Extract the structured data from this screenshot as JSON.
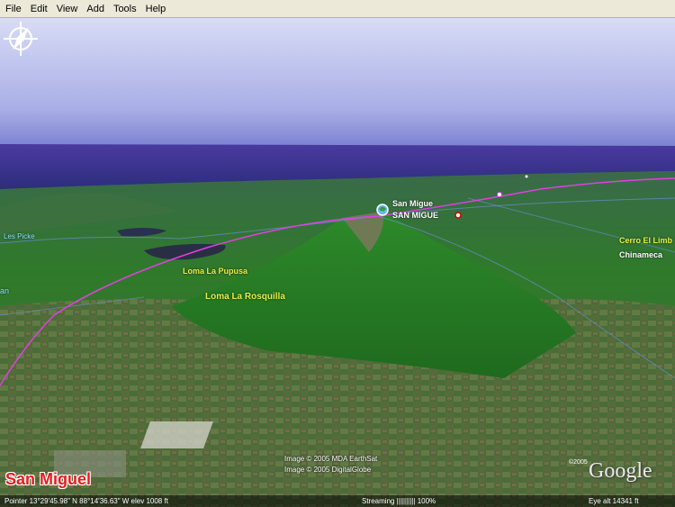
{
  "menu": {
    "items": [
      "File",
      "Edit",
      "View",
      "Add",
      "Tools",
      "Help"
    ]
  },
  "map": {
    "labels": {
      "san_miguel_point": "San Migue",
      "san_miguel_city": "SAN MIGUE",
      "loma_pupusa": "Loma La Pupusa",
      "loma_rosquilla": "Loma La Rosquilla",
      "cerro_el_limbo": "Cerro El Limb",
      "chinameca": "Chinameca",
      "los_picke": "Les Picke",
      "left_edge": "an"
    },
    "place_title": "San Miguel",
    "copyright_line1": "Image © 2005 MDA EarthSat",
    "copyright_line2": "Image © 2005 DigitalGlobe",
    "google_copyright": "©2005",
    "google_logo": "Google"
  },
  "status": {
    "pointer": "Pointer  13°29'45.98\" N   88°14'36.63\" W   elev  1008 ft",
    "streaming": "Streaming ||||||||||  100%",
    "eye_alt": "Eye  alt    14341 ft"
  },
  "colors": {
    "sky_top": "#dcdcf4",
    "horizon": "#3a2d8c",
    "terrain": "#2f7a2a",
    "route": "#e040e0"
  }
}
